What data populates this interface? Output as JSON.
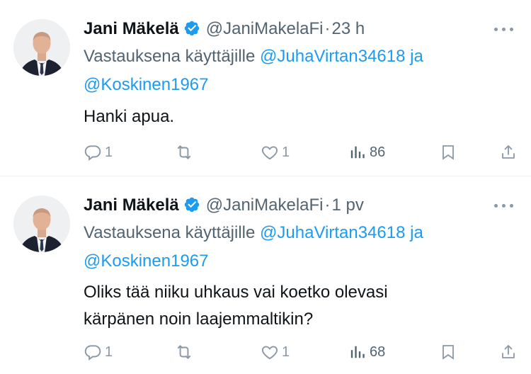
{
  "colors": {
    "link": "#1d9bf0",
    "muted": "#536471",
    "icon": "#8b98a5",
    "verified": "#1d9bf0"
  },
  "tweets": [
    {
      "author_name": "Jani Mäkelä",
      "handle": "@JaniMakelaFi",
      "separator": "·",
      "time": "23 h",
      "reply_prefix": "Vastauksena käyttäjille",
      "mention_1": "@JuhaVirtan34618",
      "reply_join": "ja",
      "mention_2": "@Koskinen1967",
      "text_lines": [
        "Hanki apua."
      ],
      "replies": "1",
      "retweets": "",
      "likes": "1",
      "views": "86"
    },
    {
      "author_name": "Jani Mäkelä",
      "handle": "@JaniMakelaFi",
      "separator": "·",
      "time": "1 pv",
      "reply_prefix": "Vastauksena käyttäjille",
      "mention_1": "@JuhaVirtan34618",
      "reply_join": "ja",
      "mention_2": "@Koskinen1967",
      "text_lines": [
        "Oliks tää niiku uhkaus vai koetko olevasi",
        "kärpänen noin laajemmaltikin?"
      ],
      "replies": "1",
      "retweets": "",
      "likes": "1",
      "views": "68"
    }
  ]
}
